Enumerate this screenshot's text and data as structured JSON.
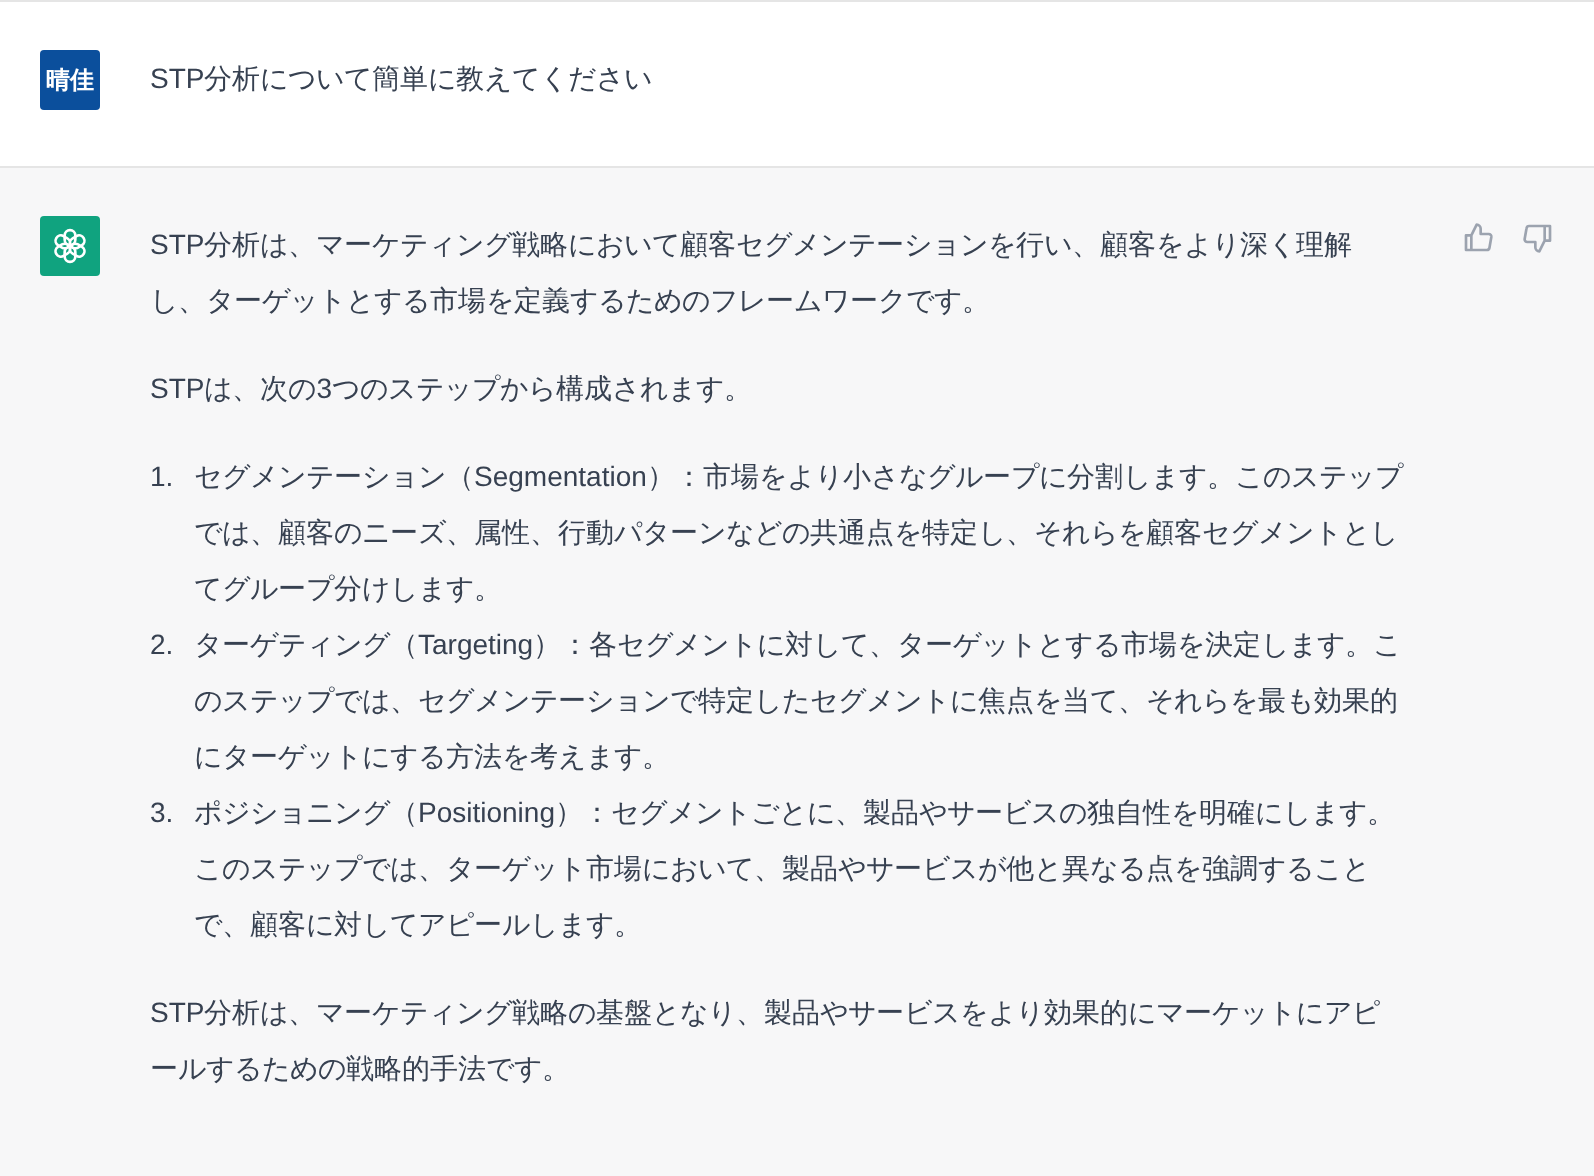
{
  "messages": [
    {
      "kind": "user",
      "avatar_label": "晴佳",
      "paragraphs": [
        "STP分析について簡単に教えてください"
      ]
    },
    {
      "kind": "assistant",
      "blocks": [
        {
          "kind": "paragraph",
          "text": "STP分析は、マーケティング戦略において顧客セグメンテーションを行い、顧客をより深く理解し、ターゲットとする市場を定義するためのフレームワークです。"
        },
        {
          "kind": "paragraph",
          "text": "STPは、次の3つのステップから構成されます。"
        },
        {
          "kind": "list",
          "items": [
            {
              "number": "1.",
              "text": "セグメンテーション（Segmentation）：市場をより小さなグループに分割します。このステップでは、顧客のニーズ、属性、行動パターンなどの共通点を特定し、それらを顧客セグメントとしてグループ分けします。"
            },
            {
              "number": "2.",
              "text": "ターゲティング（Targeting）：各セグメントに対して、ターゲットとする市場を決定します。このステップでは、セグメンテーションで特定したセグメントに焦点を当て、それらを最も効果的にターゲットにする方法を考えます。"
            },
            {
              "number": "3.",
              "text": "ポジショニング（Positioning）：セグメントごとに、製品やサービスの独自性を明確にします。このステップでは、ターゲット市場において、製品やサービスが他と異なる点を強調することで、顧客に対してアピールします。"
            }
          ]
        },
        {
          "kind": "paragraph",
          "text": "STP分析は、マーケティング戦略の基盤となり、製品やサービスをより効果的にマーケットにアピールするための戦略的手法です。"
        }
      ]
    }
  ]
}
